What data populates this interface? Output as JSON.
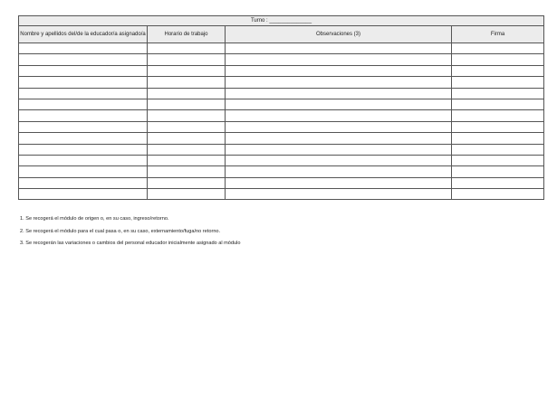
{
  "table": {
    "turno_label": "Turno : ______________",
    "headers": [
      "Nombre y apellidos del/de la educador/a asignado/a",
      "Horario de trabajo",
      "Observaciones (3)",
      "Firma"
    ],
    "empty_row_count": 14
  },
  "notes": [
    "1. Se recogerá el módulo de origen o, en su caso, ingreso/retorno.",
    "2. Se recogerá el módulo para el cual pasa o, en su caso, externamiento/fuga/no retorno.",
    "3. Se recogerán las variaciones o cambios del personal educador inicialmente asignado al módulo"
  ]
}
